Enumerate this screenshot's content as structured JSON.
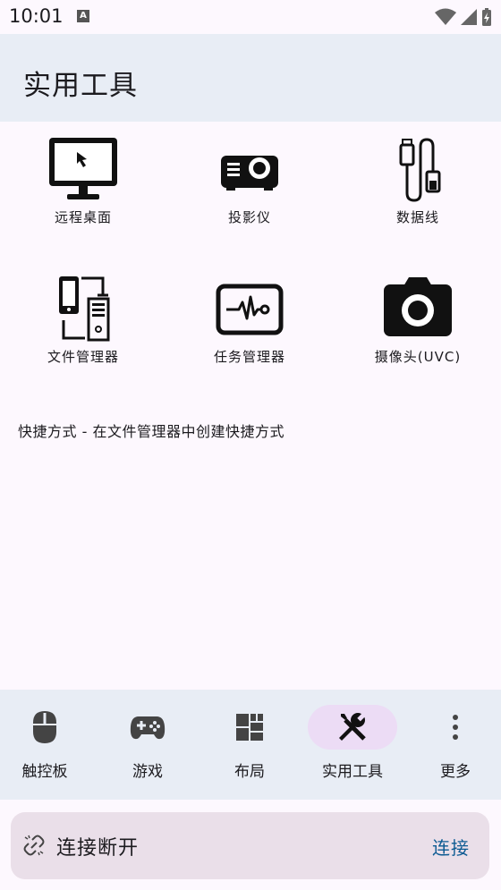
{
  "status_bar": {
    "time": "10:01",
    "notification_letter": "A"
  },
  "app_bar": {
    "title": "实用工具"
  },
  "tools": [
    {
      "label": "远程桌面",
      "icon": "monitor-icon"
    },
    {
      "label": "投影仪",
      "icon": "projector-icon"
    },
    {
      "label": "数据线",
      "icon": "usb-cable-icon"
    },
    {
      "label": "文件管理器",
      "icon": "file-transfer-icon"
    },
    {
      "label": "任务管理器",
      "icon": "activity-monitor-icon"
    },
    {
      "label": "摄像头(UVC)",
      "icon": "camera-icon"
    }
  ],
  "hint": "快捷方式 - 在文件管理器中创建快捷方式",
  "bottom_nav": [
    {
      "label": "触控板",
      "icon": "mouse-icon",
      "active": false
    },
    {
      "label": "游戏",
      "icon": "gamepad-icon",
      "active": false
    },
    {
      "label": "布局",
      "icon": "layout-icon",
      "active": false
    },
    {
      "label": "实用工具",
      "icon": "tools-icon",
      "active": true
    },
    {
      "label": "更多",
      "icon": "more-vert-icon",
      "active": false
    }
  ],
  "connection": {
    "status": "连接断开",
    "action": "连接"
  },
  "colors": {
    "app_bar_bg": "#e8edf5",
    "active_indicator": "#ecdcf5",
    "connect_link": "#0b5a92"
  }
}
